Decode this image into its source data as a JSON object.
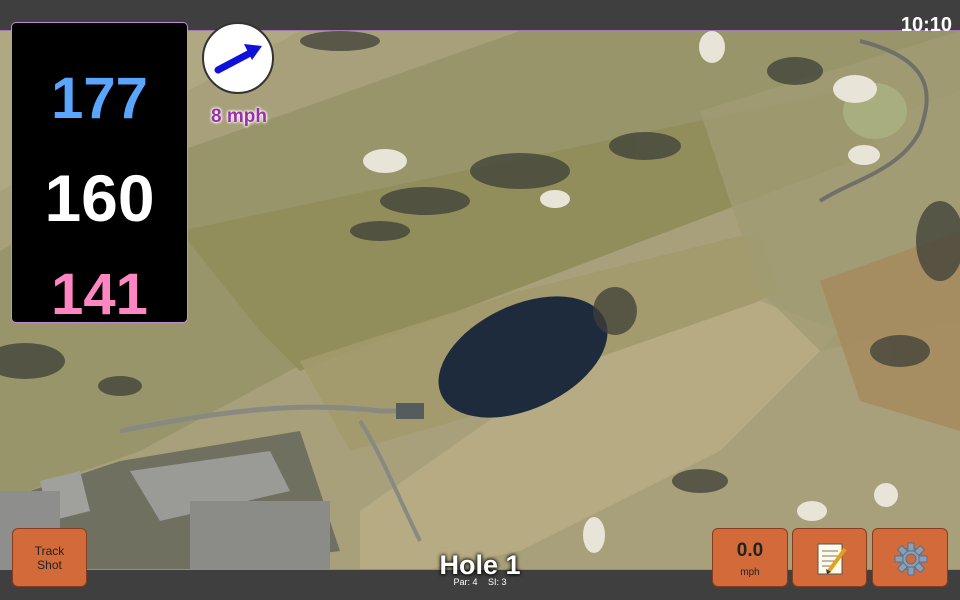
{
  "clock": "10:10",
  "distances": {
    "back": "177",
    "middle": "160",
    "front": "141"
  },
  "wind": {
    "speed": "8 mph",
    "direction_icon": "wind-arrow-icon"
  },
  "hole": {
    "title": "Hole 1",
    "par": "Par: 4",
    "stroke_index": "SI: 3"
  },
  "buttons": {
    "track_shot_line1": "Track",
    "track_shot_line2": "Shot",
    "speed_value": "0.0",
    "speed_unit": "mph",
    "notes_icon": "notepad-icon",
    "settings_icon": "gear-icon"
  },
  "colors": {
    "back": "#5aa6ff",
    "middle": "#ffffff",
    "front": "#ff86c3",
    "button": "#d36a3a",
    "wind_text": "#9b2fa8"
  }
}
